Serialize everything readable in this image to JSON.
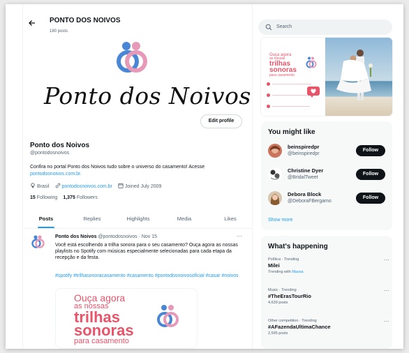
{
  "header": {
    "title": "Ponto dos Noivos",
    "posts_count": "180 posts",
    "back_icon": "arrow-left-icon"
  },
  "profile": {
    "banner_text": "Ponto dos Noivos",
    "edit_button": "Edit profile",
    "name": "Ponto dos Noivos",
    "handle": "@pontodosnoivos",
    "bio_text": "Confira no portal Ponto dos Noivos tudo sobre o universo do casamento! Acesse",
    "bio_link": "pontodosnoivos.com.br.",
    "location": "Brasil",
    "website": "pontodosnoivos.com.br",
    "joined": "Joined July 2009",
    "following_count": "15",
    "following_label": "Following",
    "followers_count": "1,375",
    "followers_label": "Followers"
  },
  "tabs": [
    {
      "label": "Posts",
      "active": true
    },
    {
      "label": "Replies",
      "active": false
    },
    {
      "label": "Highlights",
      "active": false
    },
    {
      "label": "Media",
      "active": false
    },
    {
      "label": "Likes",
      "active": false
    }
  ],
  "tweet": {
    "author": "Ponto dos Noivos",
    "handle_date": "@pontodosnoivos · Nov 15",
    "more": "···",
    "text": "Você está escolhendo a trilha sonora para o seu casamento? Ouça agora as nossas playlists no Spotify com músicas especialmente selecionadas para cada etapa da recepção e da festa.",
    "hashtags": "#spotify #trilhasonoracasamento #casamento #pontodosnoivosoficial #casar #noivos",
    "media": {
      "line1": "Ouça agora",
      "line2": "as nossas",
      "line3": "trilhas",
      "line4": "sonoras",
      "line5": "para casamento"
    }
  },
  "sidebar": {
    "search_placeholder": "Search",
    "pinned_card": {
      "line1": "Ouça agora",
      "line2": "as nossas",
      "line3": "trilhas",
      "line4": "sonoras",
      "line5": "para casamento"
    },
    "who_to_follow": {
      "title": "You might like",
      "items": [
        {
          "name": "beinspiredpr",
          "handle": "@beinspiredpr",
          "button": "Follow"
        },
        {
          "name": "Christine Dyer",
          "handle": "@BridalTweet",
          "button": "Follow"
        },
        {
          "name": "Debora Block",
          "handle": "@DeboraFBergamo",
          "button": "Follow"
        }
      ],
      "show_more": "Show more"
    },
    "trends": {
      "title": "What's happening",
      "items": [
        {
          "context": "Política · Trending",
          "name": "Milei",
          "sub_prefix": "Trending with",
          "sub_highlight": "Massa"
        },
        {
          "context": "Music · Trending",
          "name": "#TheErasTourRio",
          "sub_prefix": "4,639 posts",
          "sub_highlight": ""
        },
        {
          "context": "Other competition · Trending",
          "name": "#AFazendaUltimaChance",
          "sub_prefix": "2,595 posts",
          "sub_highlight": ""
        }
      ]
    }
  },
  "colors": {
    "accent": "#1d9bf0",
    "promo_pink": "#e8546a",
    "ring_blue": "#4a86d6",
    "ring_pink": "#e79ab8"
  }
}
